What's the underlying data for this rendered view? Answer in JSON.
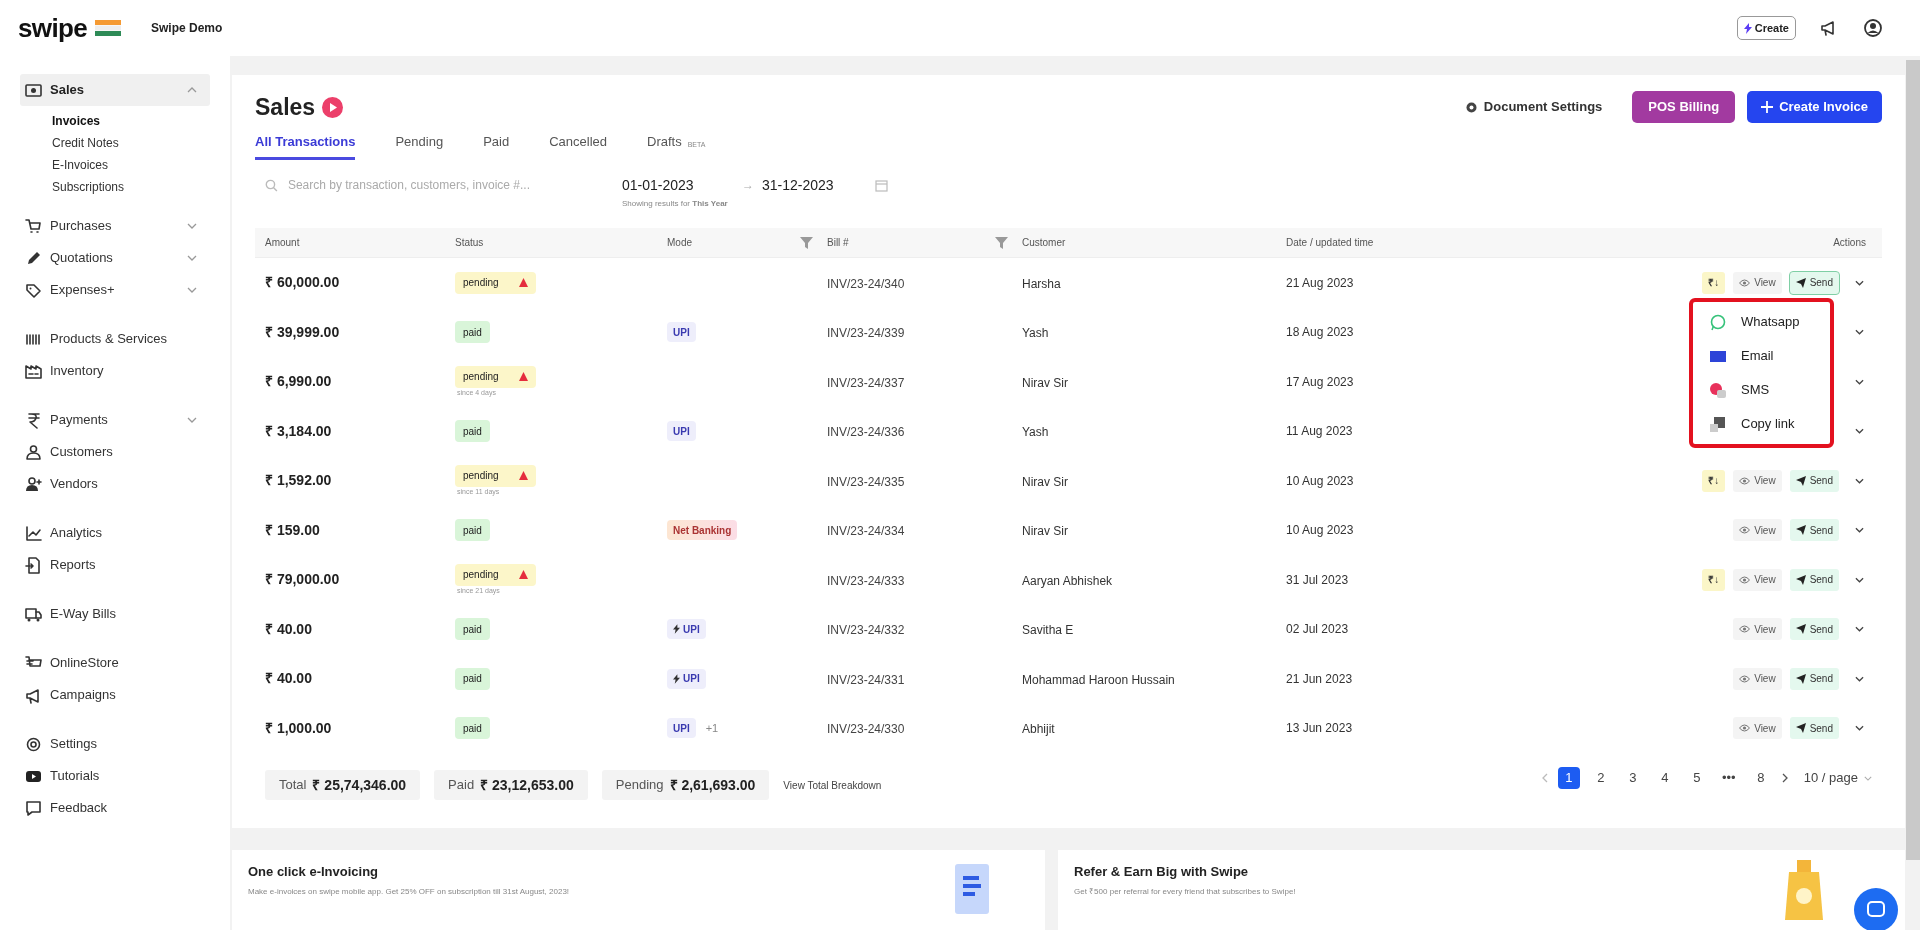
{
  "header": {
    "logo": "swipe",
    "company": "Swipe Demo",
    "create_button": "Create"
  },
  "sidebar": {
    "sections": [
      [
        {
          "label": "Sales",
          "expanded": true,
          "selected": true,
          "children": [
            {
              "label": "Invoices",
              "selected": true
            },
            {
              "label": "Credit Notes",
              "selected": false
            },
            {
              "label": "E-Invoices",
              "selected": false
            },
            {
              "label": "Subscriptions",
              "selected": false
            }
          ]
        },
        {
          "label": "Purchases",
          "expanded": false,
          "selected": false
        },
        {
          "label": "Quotations",
          "expanded": false,
          "selected": false
        },
        {
          "label": "Expenses+",
          "expanded": false,
          "selected": false
        }
      ],
      [
        {
          "label": "Products & Services",
          "selected": false
        },
        {
          "label": "Inventory",
          "selected": false
        }
      ],
      [
        {
          "label": "Payments",
          "expanded": false,
          "selected": false
        },
        {
          "label": "Customers",
          "selected": false
        },
        {
          "label": "Vendors",
          "selected": false
        }
      ],
      [
        {
          "label": "Analytics",
          "selected": false
        },
        {
          "label": "Reports",
          "selected": false
        }
      ],
      [
        {
          "label": "E-Way Bills",
          "selected": false
        }
      ],
      [
        {
          "label": "OnlineStore",
          "selected": false
        },
        {
          "label": "Campaigns",
          "selected": false
        }
      ],
      [
        {
          "label": "Settings",
          "selected": false
        },
        {
          "label": "Tutorials",
          "selected": false
        },
        {
          "label": "Feedback",
          "selected": false
        }
      ]
    ]
  },
  "page": {
    "title": "Sales",
    "document_settings": "Document Settings",
    "pos_button": "POS Billing",
    "create_button": "Create Invoice"
  },
  "tabs": [
    {
      "label": "All Transactions",
      "selected": true
    },
    {
      "label": "Pending",
      "selected": false
    },
    {
      "label": "Paid",
      "selected": false
    },
    {
      "label": "Cancelled",
      "selected": false
    },
    {
      "label": "Drafts",
      "selected": false,
      "badge": "BETA"
    }
  ],
  "filters": {
    "search_placeholder": "Search by transaction, customers, invoice #...",
    "date_from": "01-01-2023",
    "date_arrow": "→",
    "date_to": "31-12-2023",
    "note": "Showing results for **This Year**"
  },
  "table": {
    "columns": [
      "Amount",
      "Status",
      "Mode",
      "Bill #",
      "Customer",
      "Date / updated time",
      "Actions"
    ],
    "rows": [
      {
        "amount": "₹ 60,000.00",
        "status": "pending",
        "modes": [],
        "bill": "INV/23-24/340",
        "customer": "Harsha",
        "date": "21 Aug 2023",
        "actions": [
          {
            "kind": "collect",
            "label": "₹↓"
          },
          {
            "kind": "view",
            "label": "View"
          },
          {
            "kind": "send",
            "label": "Send",
            "selected": true
          }
        ]
      },
      {
        "amount": "₹ 39,999.00",
        "status": "paid",
        "modes": [
          {
            "kind": "upi",
            "label": "UPI",
            "flash": false
          }
        ],
        "bill": "INV/23-24/339",
        "customer": "Yash",
        "date": "18 Aug 2023",
        "actions": []
      },
      {
        "amount": "₹ 6,990.00",
        "status": "pending",
        "since": "since 4 days",
        "modes": [],
        "bill": "INV/23-24/337",
        "customer": "Nirav Sir",
        "date": "17 Aug 2023",
        "actions": []
      },
      {
        "amount": "₹ 3,184.00",
        "status": "paid",
        "modes": [
          {
            "kind": "upi",
            "label": "UPI",
            "flash": false
          }
        ],
        "bill": "INV/23-24/336",
        "customer": "Yash",
        "date": "11 Aug 2023",
        "actions": []
      },
      {
        "amount": "₹ 1,592.00",
        "status": "pending",
        "since": "since 11 days",
        "modes": [],
        "bill": "INV/23-24/335",
        "customer": "Nirav Sir",
        "date": "10 Aug 2023",
        "actions": [
          {
            "kind": "collect",
            "label": "₹↓"
          },
          {
            "kind": "view",
            "label": "View"
          },
          {
            "kind": "send",
            "label": "Send",
            "selected": false
          }
        ]
      },
      {
        "amount": "₹ 159.00",
        "status": "paid",
        "modes": [
          {
            "kind": "netbanking",
            "label": "Net Banking",
            "flash": false
          }
        ],
        "bill": "INV/23-24/334",
        "customer": "Nirav Sir",
        "date": "10 Aug 2023",
        "actions": [
          {
            "kind": "view",
            "label": "View"
          },
          {
            "kind": "send",
            "label": "Send",
            "selected": false
          }
        ]
      },
      {
        "amount": "₹ 79,000.00",
        "status": "pending",
        "since": "since 21 days",
        "modes": [],
        "bill": "INV/23-24/333",
        "customer": "Aaryan Abhishek",
        "date": "31 Jul 2023",
        "actions": [
          {
            "kind": "collect",
            "label": "₹↓"
          },
          {
            "kind": "view",
            "label": "View"
          },
          {
            "kind": "send",
            "label": "Send",
            "selected": false
          }
        ]
      },
      {
        "amount": "₹ 40.00",
        "status": "paid",
        "modes": [
          {
            "kind": "upi",
            "label": "UPI",
            "flash": true
          }
        ],
        "bill": "INV/23-24/332",
        "customer": "Savitha E",
        "date": "02 Jul 2023",
        "actions": [
          {
            "kind": "view",
            "label": "View"
          },
          {
            "kind": "send",
            "label": "Send",
            "selected": false
          }
        ]
      },
      {
        "amount": "₹ 40.00",
        "status": "paid",
        "modes": [
          {
            "kind": "upi",
            "label": "UPI",
            "flash": true
          }
        ],
        "bill": "INV/23-24/331",
        "customer": "Mohammad Haroon Hussain",
        "date": "21 Jun 2023",
        "actions": [
          {
            "kind": "view",
            "label": "View"
          },
          {
            "kind": "send",
            "label": "Send",
            "selected": false
          }
        ]
      },
      {
        "amount": "₹ 1,000.00",
        "status": "paid",
        "modes": [
          {
            "kind": "upi",
            "label": "UPI",
            "flash": false
          }
        ],
        "extra_modes": "+1",
        "bill": "INV/23-24/330",
        "customer": "Abhijit",
        "date": "13 Jun 2023",
        "actions": [
          {
            "kind": "view",
            "label": "View"
          },
          {
            "kind": "send",
            "label": "Send",
            "selected": false
          }
        ]
      }
    ]
  },
  "send_menu": [
    {
      "kind": "whatsapp",
      "label": "Whatsapp"
    },
    {
      "kind": "email",
      "label": "Email"
    },
    {
      "kind": "sms",
      "label": "SMS"
    },
    {
      "kind": "copy",
      "label": "Copy link"
    }
  ],
  "totals": [
    {
      "label": "Total",
      "value": "₹ 25,74,346.00"
    },
    {
      "label": "Paid",
      "value": "₹ 23,12,653.00"
    },
    {
      "label": "Pending",
      "value": "₹ 2,61,693.00"
    }
  ],
  "breakdown_link": "View Total Breakdown",
  "pagination": {
    "pages": [
      {
        "label": "1",
        "selected": true
      },
      {
        "label": "2",
        "selected": false
      },
      {
        "label": "3",
        "selected": false
      },
      {
        "label": "4",
        "selected": false
      },
      {
        "label": "5",
        "selected": false
      },
      {
        "label": "•••",
        "selected": false
      },
      {
        "label": "8",
        "selected": false
      }
    ],
    "page_size": "10 / page"
  },
  "promos": [
    {
      "title": "One click e-Invoicing",
      "text": "Make e-invoices on swipe mobile app. Get 25% OFF on subscription till 31st August, 2023!"
    },
    {
      "title": "Refer & Earn Big with Swipe",
      "text": "Get ₹500 per referral for every friend that subscribes to Swipe!"
    }
  ]
}
